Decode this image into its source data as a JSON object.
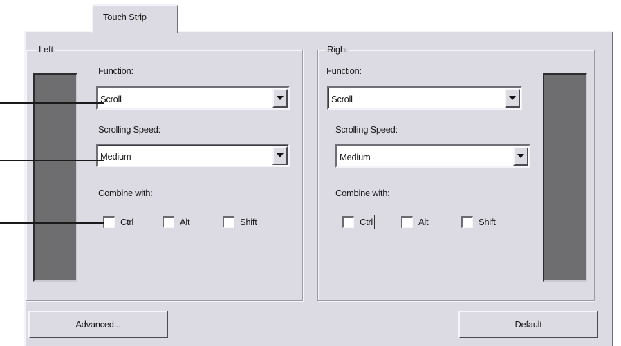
{
  "tab": {
    "label": "Touch Strip"
  },
  "left": {
    "title": "Left",
    "function_label": "Function:",
    "function_value": "Scroll",
    "speed_label": "Scrolling Speed:",
    "speed_value": "Medium",
    "combine_label": "Combine with:",
    "modifiers": [
      "Ctrl",
      "Alt",
      "Shift"
    ]
  },
  "right": {
    "title": "Right",
    "function_label": "Function:",
    "function_value": "Scroll",
    "speed_label": "Scrolling Speed:",
    "speed_value": "Medium",
    "combine_label": "Combine with:",
    "modifiers": [
      "Ctrl",
      "Alt",
      "Shift"
    ]
  },
  "buttons": {
    "advanced": "Advanced...",
    "default": "Default"
  },
  "icons": {
    "dropdown": "chevron-down-icon"
  }
}
